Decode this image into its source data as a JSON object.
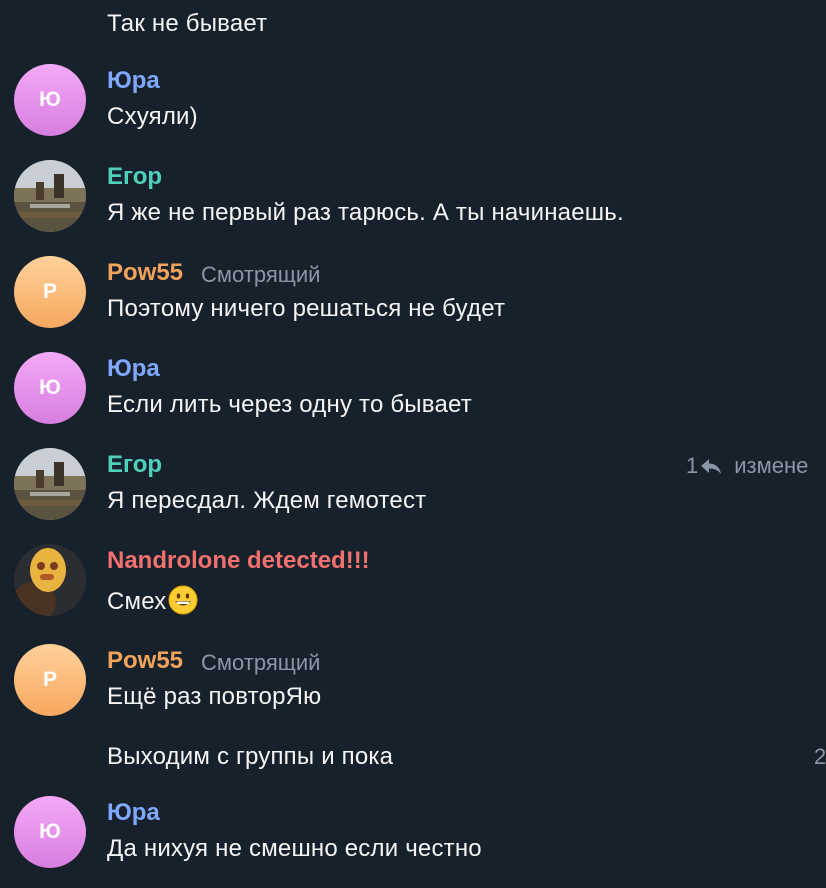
{
  "messages": [
    {
      "text": "Так не бывает"
    },
    {
      "sender": "Юра",
      "avatar_letter": "Ю",
      "text": "Схуяли)"
    },
    {
      "sender": "Егор",
      "text": "Я же не первый раз тарюсь. А ты начинаешь."
    },
    {
      "sender": "Pow55",
      "role": "Смотрящий",
      "avatar_letter": "P",
      "text": "Поэтому ничего решаться не будет"
    },
    {
      "sender": "Юра",
      "avatar_letter": "Ю",
      "text": "Если лить через одну то бывает"
    },
    {
      "sender": "Егор",
      "text": "Я пересдал. Ждем гемотест",
      "reply_count": "1",
      "edited_label": "измене"
    },
    {
      "sender": "Nandrolone detected!!!",
      "text": "Смех"
    },
    {
      "sender": "Pow55",
      "role": "Смотрящий",
      "avatar_letter": "P",
      "text": "Ещё раз повторЯю"
    },
    {
      "text": "Выходим с группы и пока",
      "meta_fragment": "2"
    },
    {
      "sender": "Юра",
      "avatar_letter": "Ю",
      "text": "Да нихуя не смешно если честно"
    }
  ],
  "colors": {
    "background": "#17212b",
    "sender_yura": "#7fa8ff",
    "sender_egor": "#4fd1b7",
    "sender_pow": "#f2a35b",
    "sender_nandro": "#f2706e",
    "muted": "#8a97a5"
  },
  "icons": {
    "reply": "reply-arrow-icon",
    "emoji": "grinning-face-emoji-icon"
  }
}
